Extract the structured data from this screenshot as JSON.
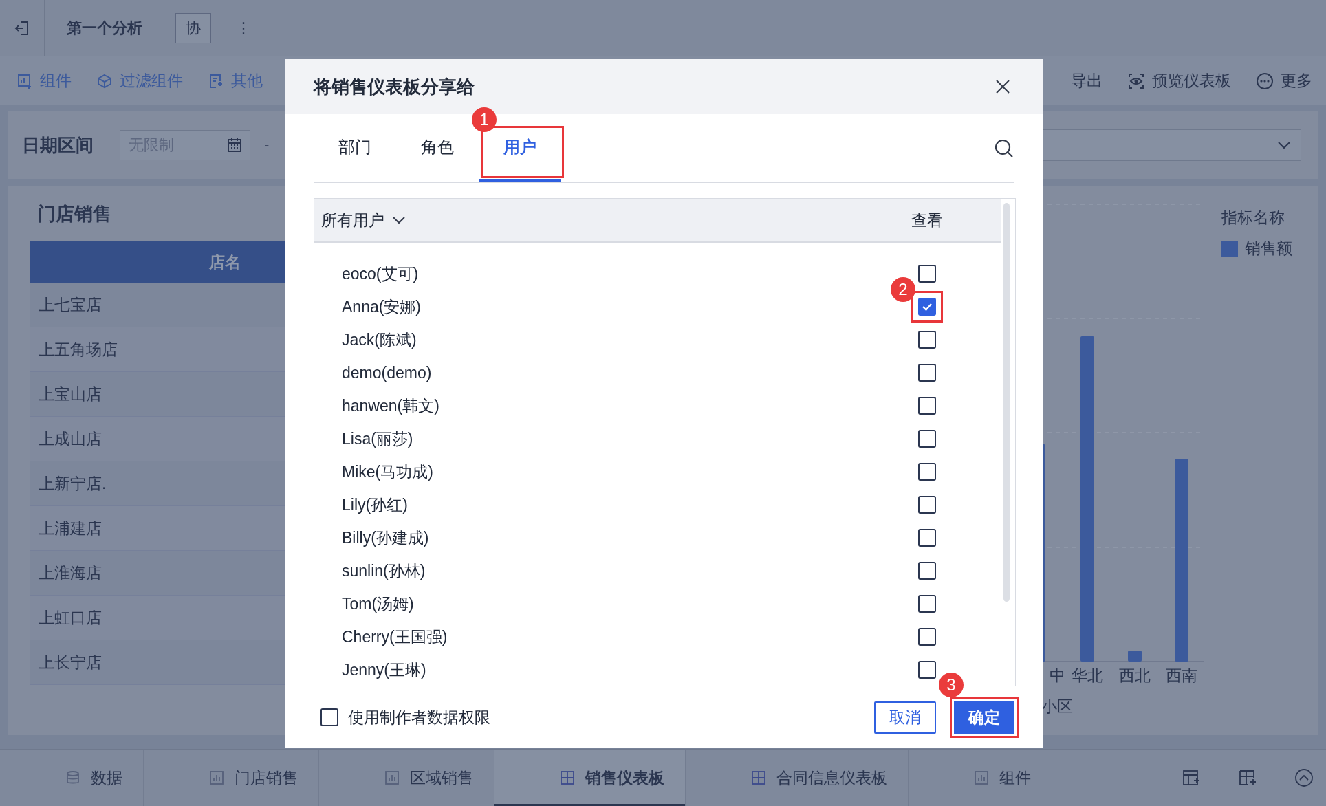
{
  "topbar": {
    "title": "第一个分析",
    "tag": "协",
    "more": "⋮"
  },
  "toolbar": {
    "left": [
      "组件",
      "过滤组件",
      "其他"
    ],
    "right": [
      "导出",
      "预览仪表板",
      "更多"
    ]
  },
  "filter": {
    "label": "日期区间",
    "field_value": "无限制",
    "separator": "-"
  },
  "store_panel": {
    "title": "门店销售",
    "column": "店名",
    "rows": [
      "上七宝店",
      "上五角场店",
      "上宝山店",
      "上成山店",
      "上新宁店.",
      "上浦建店",
      "上淮海店",
      "上虹口店",
      "上长宁店"
    ]
  },
  "region_chart": {
    "x_labels": [
      "中",
      "华北",
      "西北",
      "西南"
    ],
    "axis_title": "小区",
    "legend_title": "指标名称",
    "legend_items": [
      {
        "label": "销售额",
        "color": "#3c5a9c"
      }
    ]
  },
  "dialog": {
    "title": "将销售仪表板分享给",
    "tabs": [
      {
        "label": "部门",
        "selected": false
      },
      {
        "label": "角色",
        "selected": false
      },
      {
        "label": "用户",
        "selected": true,
        "annotation": "1"
      }
    ],
    "filter_label": "所有用户",
    "view_column": "查看",
    "users": [
      {
        "name": "eoco(艾可)",
        "checked": false
      },
      {
        "name": "Anna(安娜)",
        "checked": true,
        "annotation": "2"
      },
      {
        "name": "Jack(陈斌)",
        "checked": false
      },
      {
        "name": "demo(demo)",
        "checked": false
      },
      {
        "name": "hanwen(韩文)",
        "checked": false
      },
      {
        "name": "Lisa(丽莎)",
        "checked": false
      },
      {
        "name": "Mike(马功成)",
        "checked": false
      },
      {
        "name": "Lily(孙红)",
        "checked": false
      },
      {
        "name": "Billy(孙建成)",
        "checked": false
      },
      {
        "name": "sunlin(孙林)",
        "checked": false
      },
      {
        "name": "Tom(汤姆)",
        "checked": false
      },
      {
        "name": "Cherry(王国强)",
        "checked": false
      },
      {
        "name": "Jenny(王琳)",
        "checked": false
      }
    ],
    "use_author_permission": {
      "label": "使用制作者数据权限",
      "checked": false
    },
    "cancel": "取消",
    "confirm": {
      "label": "确定",
      "annotation": "3"
    }
  },
  "bottom_tabs": [
    {
      "label": "数据",
      "selected": false
    },
    {
      "label": "门店销售",
      "selected": false
    },
    {
      "label": "区域销售",
      "selected": false
    },
    {
      "label": "销售仪表板",
      "selected": true
    },
    {
      "label": "合同信息仪表板",
      "selected": false
    },
    {
      "label": "组件",
      "selected": false
    }
  ]
}
